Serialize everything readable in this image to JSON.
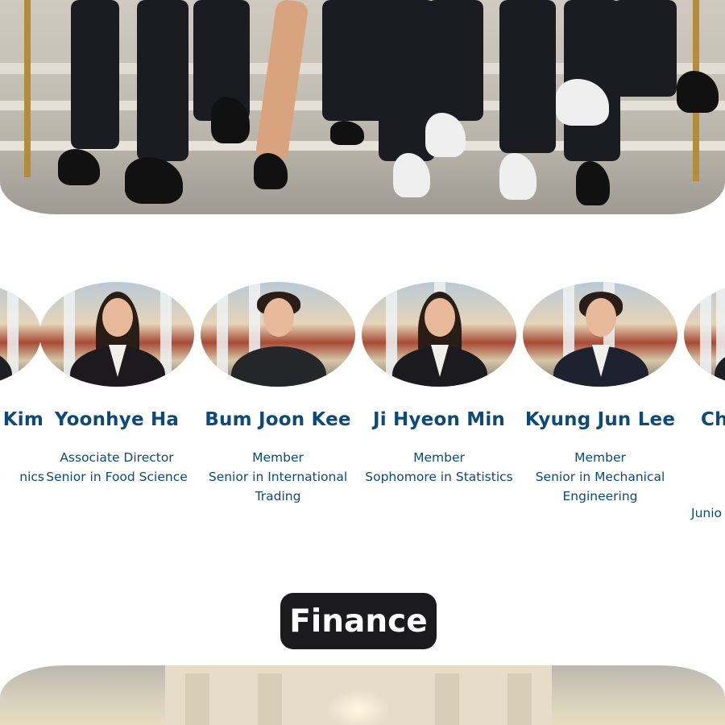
{
  "members": [
    {
      "name": "Kim",
      "role": "",
      "major": "nics",
      "major2": ""
    },
    {
      "name": "Yoonhye Ha",
      "role": "Associate Director",
      "major": "Senior in Food Science",
      "major2": ""
    },
    {
      "name": "Bum Joon Kee",
      "role": "Member",
      "major": "Senior in International",
      "major2": "Trading"
    },
    {
      "name": "Ji Hyeon Min",
      "role": "Member",
      "major": "Sophomore in Statistics",
      "major2": ""
    },
    {
      "name": "Kyung Jun Lee",
      "role": "Member",
      "major": "Senior in Mechanical",
      "major2": "Engineering"
    },
    {
      "name": "Ch",
      "role": "",
      "major": "",
      "major2": "Junio"
    }
  ],
  "section": {
    "title": "Finance"
  },
  "colors": {
    "name_text": "#0d4a78",
    "badge_bg": "#1b1b1d",
    "badge_text": "#ffffff"
  }
}
